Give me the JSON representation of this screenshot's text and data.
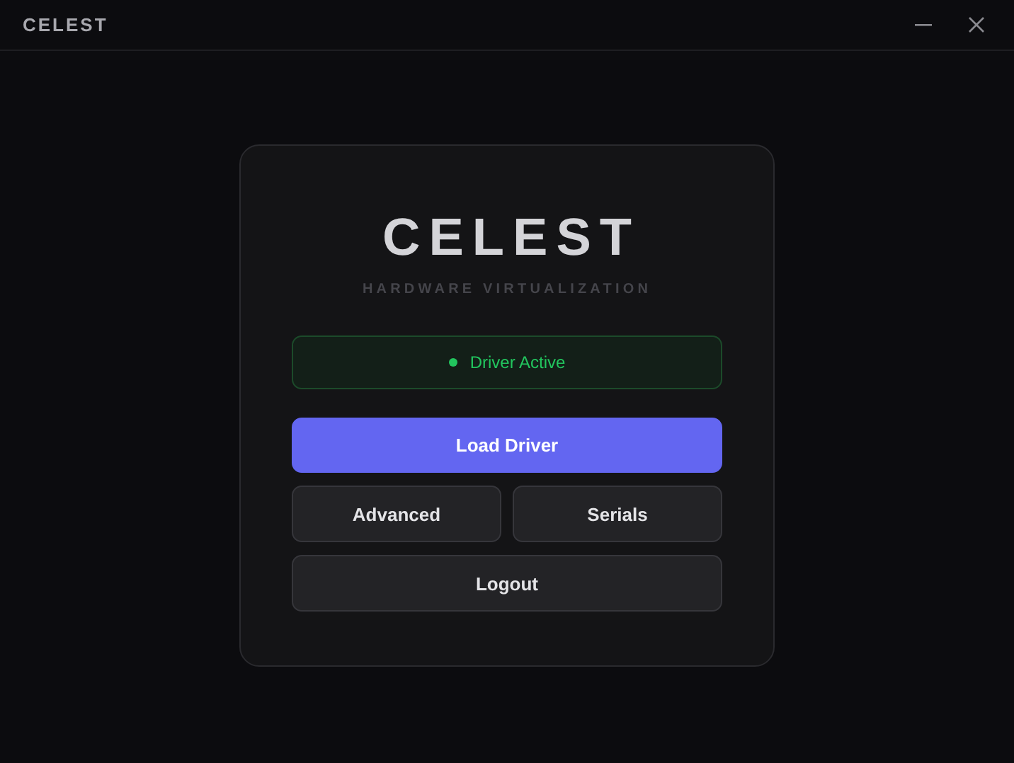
{
  "window": {
    "title": "CELEST"
  },
  "card": {
    "logo": "CELEST",
    "subtitle": "HARDWARE VIRTUALIZATION",
    "status": {
      "label": "Driver Active",
      "color": "#22c55e"
    },
    "buttons": [
      {
        "label": "Load Driver",
        "kind": "primary"
      },
      {
        "label": "Advanced",
        "kind": "secondary"
      },
      {
        "label": "Serials",
        "kind": "secondary"
      },
      {
        "label": "Logout",
        "kind": "wide"
      }
    ]
  }
}
